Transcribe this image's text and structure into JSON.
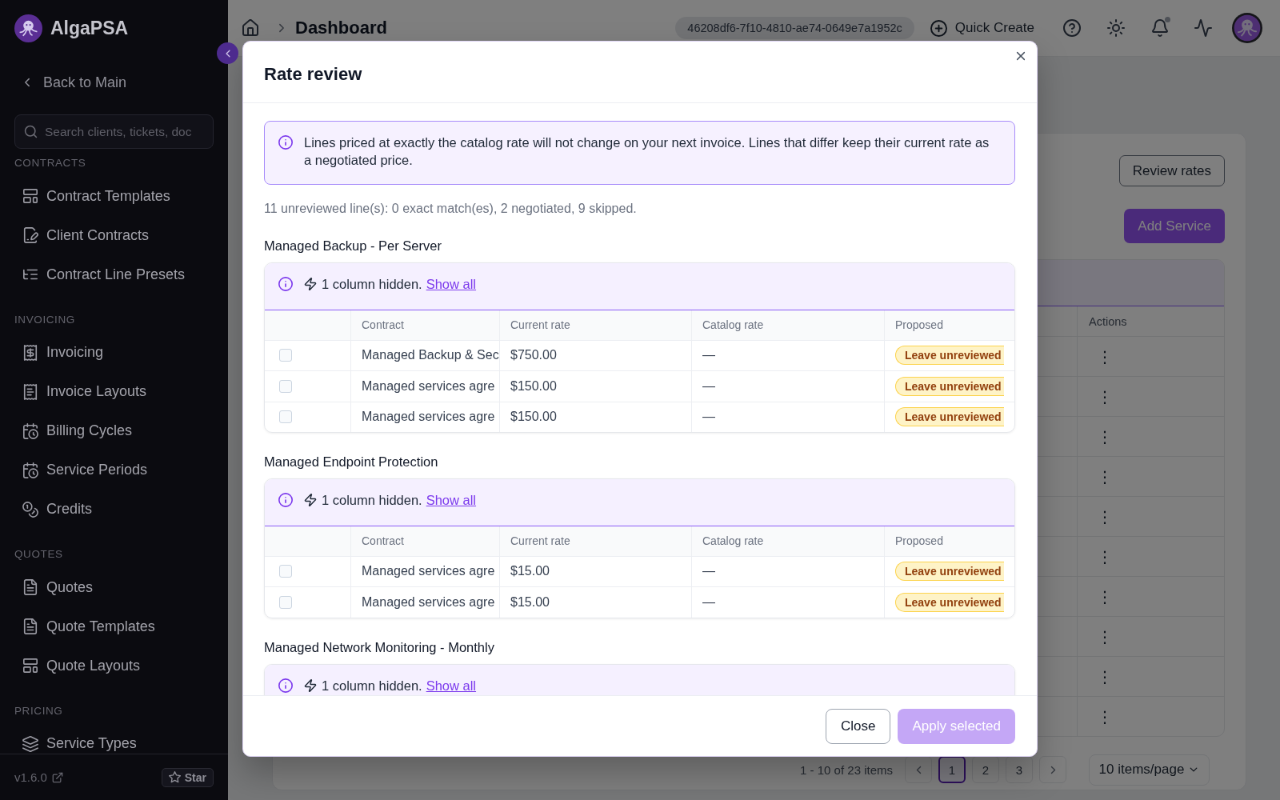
{
  "sidebar": {
    "brand": "AlgaPSA",
    "back_link": "Back to Main",
    "search": {
      "placeholder": "Search clients, tickets, doc"
    },
    "sections": [
      {
        "title": "CONTRACTS",
        "items": [
          {
            "label": "Contract Templates"
          },
          {
            "label": "Client Contracts"
          },
          {
            "label": "Contract Line Presets"
          }
        ]
      },
      {
        "title": "INVOICING",
        "items": [
          {
            "label": "Invoicing"
          },
          {
            "label": "Invoice Layouts"
          },
          {
            "label": "Billing Cycles"
          },
          {
            "label": "Service Periods"
          },
          {
            "label": "Credits"
          }
        ]
      },
      {
        "title": "QUOTES",
        "items": [
          {
            "label": "Quotes"
          },
          {
            "label": "Quote Templates"
          },
          {
            "label": "Quote Layouts"
          }
        ]
      },
      {
        "title": "PRICING",
        "items": [
          {
            "label": "Service Types"
          }
        ]
      }
    ],
    "version": "v1.6.0",
    "star_button": "Star"
  },
  "header": {
    "breadcrumb": "Dashboard",
    "session_id": "46208df6-7f10-4810-ae74-0649e7a1952c",
    "quick_create": "Quick Create",
    "unread_notifications": true
  },
  "page": {
    "buttons": [
      {
        "label": "Review rates",
        "kind": "outline"
      },
      {
        "label": "Add Service",
        "kind": "primary"
      }
    ],
    "table": {
      "columns": [
        "Actions"
      ],
      "rows": [
        {
          "actions": "⋮"
        },
        {
          "actions": "⋮"
        },
        {
          "actions": "⋮"
        },
        {
          "actions": "⋮"
        },
        {
          "actions": "⋮"
        },
        {
          "actions": "⋮"
        },
        {
          "actions": "⋮"
        },
        {
          "actions": "⋮"
        },
        {
          "actions": "⋮"
        },
        {
          "actions": "⋮"
        }
      ]
    },
    "pagination": {
      "summary": "1 - 10 of 23 items",
      "pages": [
        {
          "label": "1",
          "selected": true
        },
        {
          "label": "2",
          "selected": false
        },
        {
          "label": "3",
          "selected": false
        }
      ],
      "page_size": "10 items/page"
    }
  },
  "modal": {
    "title": "Rate review",
    "notice": "Lines priced at exactly the catalog rate will not change on your next invoice. Lines that differ keep their current rate as a negotiated price.",
    "summary": "11 unreviewed line(s): 0 exact match(es), 2 negotiated, 9 skipped.",
    "groups": [
      {
        "title": "Managed Backup - Per Server",
        "hidden_note": "1 column hidden.",
        "show_all_link": "Show all",
        "columns": [
          "Contract",
          "Current rate",
          "Catalog rate",
          "Proposed"
        ],
        "rows": [
          {
            "checked": false,
            "contract": "Managed Backup & Sec",
            "current_rate": "$750.00",
            "catalog_rate": "—",
            "proposed": "Leave unreviewed"
          },
          {
            "checked": false,
            "contract": "Managed services agre",
            "current_rate": "$150.00",
            "catalog_rate": "—",
            "proposed": "Leave unreviewed"
          },
          {
            "checked": false,
            "contract": "Managed services agre",
            "current_rate": "$150.00",
            "catalog_rate": "—",
            "proposed": "Leave unreviewed"
          }
        ]
      },
      {
        "title": "Managed Endpoint Protection",
        "hidden_note": "1 column hidden.",
        "show_all_link": "Show all",
        "columns": [
          "Contract",
          "Current rate",
          "Catalog rate",
          "Proposed"
        ],
        "rows": [
          {
            "checked": false,
            "contract": "Managed services agre",
            "current_rate": "$15.00",
            "catalog_rate": "—",
            "proposed": "Leave unreviewed"
          },
          {
            "checked": false,
            "contract": "Managed services agre",
            "current_rate": "$15.00",
            "catalog_rate": "—",
            "proposed": "Leave unreviewed"
          }
        ]
      },
      {
        "title": "Managed Network Monitoring - Monthly",
        "hidden_note": "1 column hidden.",
        "show_all_link": "Show all"
      }
    ],
    "buttons": [
      {
        "label": "Close",
        "kind": "outline",
        "disabled": false
      },
      {
        "label": "Apply selected",
        "kind": "primary",
        "disabled": true
      }
    ]
  }
}
